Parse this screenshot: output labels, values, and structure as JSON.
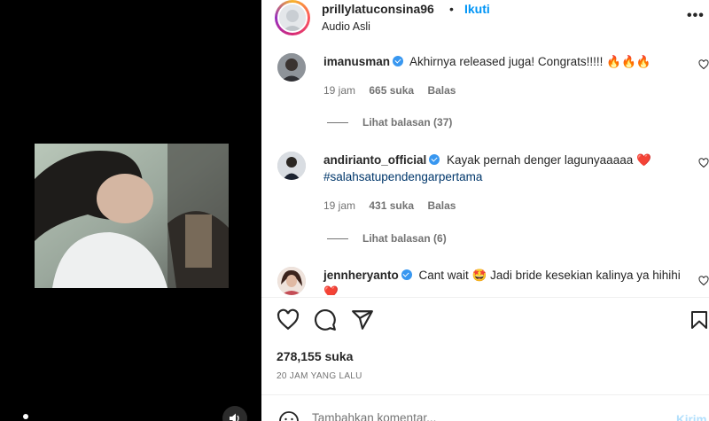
{
  "post": {
    "username": "prillylatuconsina96",
    "separator": "•",
    "follow_label": "Ikuti",
    "audio_label": "Audio Asli",
    "more_icon": "more-icon"
  },
  "comments": [
    {
      "username": "imanusman",
      "text": "Akhirnya released juga! Congrats!!!!! 🔥🔥🔥",
      "time": "19 jam",
      "likes": "665 suka",
      "reply": "Balas",
      "view_replies": "Lihat balasan (37)"
    },
    {
      "username": "andirianto_official",
      "text": "Kayak pernah denger lagunyaaaaa ❤️",
      "hashtag": "#salahsatupendengarpertama",
      "time": "19 jam",
      "likes": "431 suka",
      "reply": "Balas",
      "view_replies": "Lihat balasan (6)"
    },
    {
      "username": "jennheryanto",
      "text": "Cant wait 🤩 Jadi bride kesekian kalinya ya hihihi ❤️"
    }
  ],
  "likes_count": "278,155 suka",
  "time_ago": "20 JAM YANG LALU",
  "add_comment": {
    "placeholder": "Tambahkan komentar...",
    "post_label": "Kirim"
  },
  "colors": {
    "accent": "#0095f6",
    "verified": "#3897f0",
    "muted": "#737373",
    "left_panel": "#000000"
  }
}
